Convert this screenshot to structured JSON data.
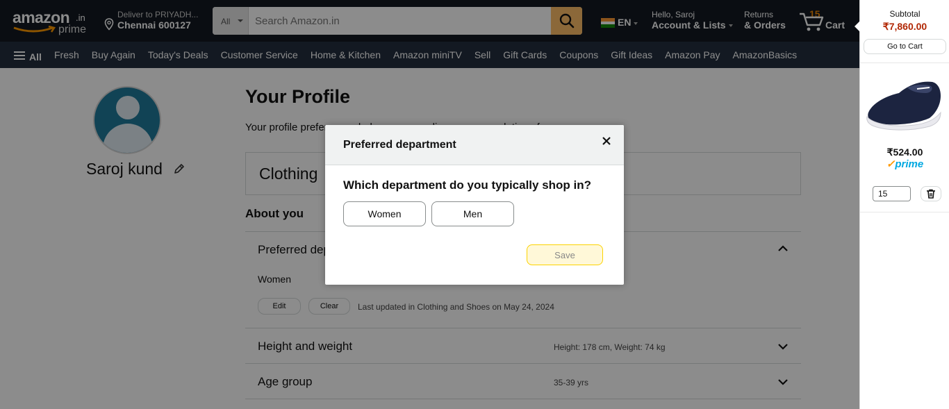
{
  "header": {
    "logo": {
      "word": "amazon",
      "tld": ".in",
      "sub": "prime"
    },
    "deliver": {
      "line1": "Deliver to PRIYADH...",
      "line2": "Chennai 600127"
    },
    "search": {
      "category": "All",
      "placeholder": "Search Amazon.in"
    },
    "language": "EN",
    "account": {
      "line1": "Hello, Saroj",
      "line2": "Account & Lists"
    },
    "orders": {
      "line1": "Returns",
      "line2": "& Orders"
    },
    "cart": {
      "count": "15",
      "label": "Cart"
    }
  },
  "subnav": {
    "all_label": "All",
    "items": [
      "Fresh",
      "Buy Again",
      "Today's Deals",
      "Customer Service",
      "Home & Kitchen",
      "Amazon miniTV",
      "Sell",
      "Gift Cards",
      "Coupons",
      "Gift Ideas",
      "Amazon Pay",
      "AmazonBasics"
    ]
  },
  "profile": {
    "name": "Saroj kund",
    "title": "Your Profile",
    "description": "Your profile preferences help us personalise recommendations for you.",
    "department_card": "Clothing",
    "about_heading": "About you",
    "rows": [
      {
        "label": "Preferred department",
        "value": "Women",
        "edit": "Edit",
        "clear": "Clear",
        "updated": "Last updated in Clothing and Shoes on May 24, 2024"
      },
      {
        "label": "Height and weight",
        "value": "Height: 178 cm, Weight: 74 kg"
      },
      {
        "label": "Age group",
        "value": "35-39 yrs"
      }
    ]
  },
  "modal": {
    "title": "Preferred department",
    "question": "Which department do you typically shop in?",
    "options": [
      "Women",
      "Men"
    ],
    "save": "Save"
  },
  "cart_panel": {
    "subtotal_label": "Subtotal",
    "subtotal_value": "₹7,860.00",
    "go_to_cart": "Go to Cart",
    "item_price": "₹524.00",
    "prime_label": "prime",
    "quantity": "15"
  },
  "colors": {
    "nav_dark": "#131921",
    "nav_sub": "#232f3e",
    "search_button": "#febd69",
    "cart_count": "#f08804",
    "price_red": "#b12704",
    "prime_blue": "#00a8e1"
  }
}
